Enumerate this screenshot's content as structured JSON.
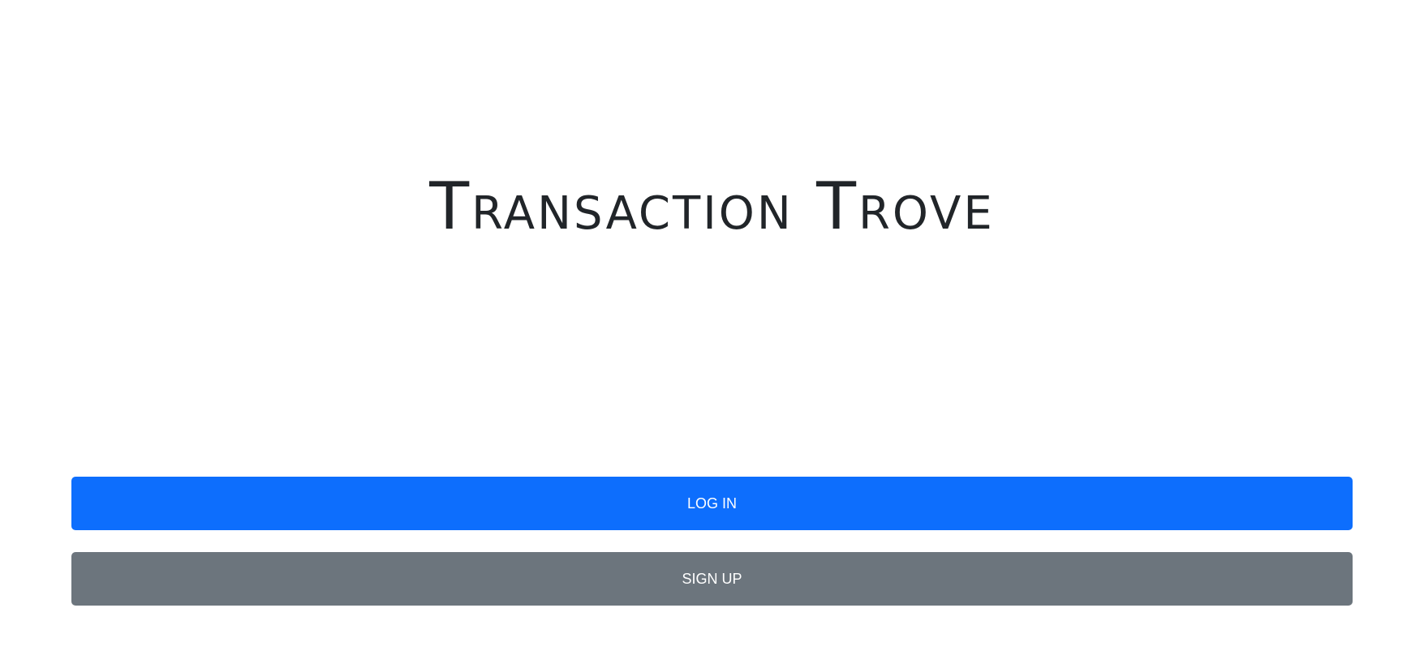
{
  "header": {
    "title": "Transaction Trove"
  },
  "actions": {
    "login_label": "LOG IN",
    "signup_label": "SIGN UP"
  },
  "colors": {
    "primary": "#0d6efd",
    "secondary": "#6c757d",
    "title_text": "#212529",
    "background": "#ffffff"
  }
}
